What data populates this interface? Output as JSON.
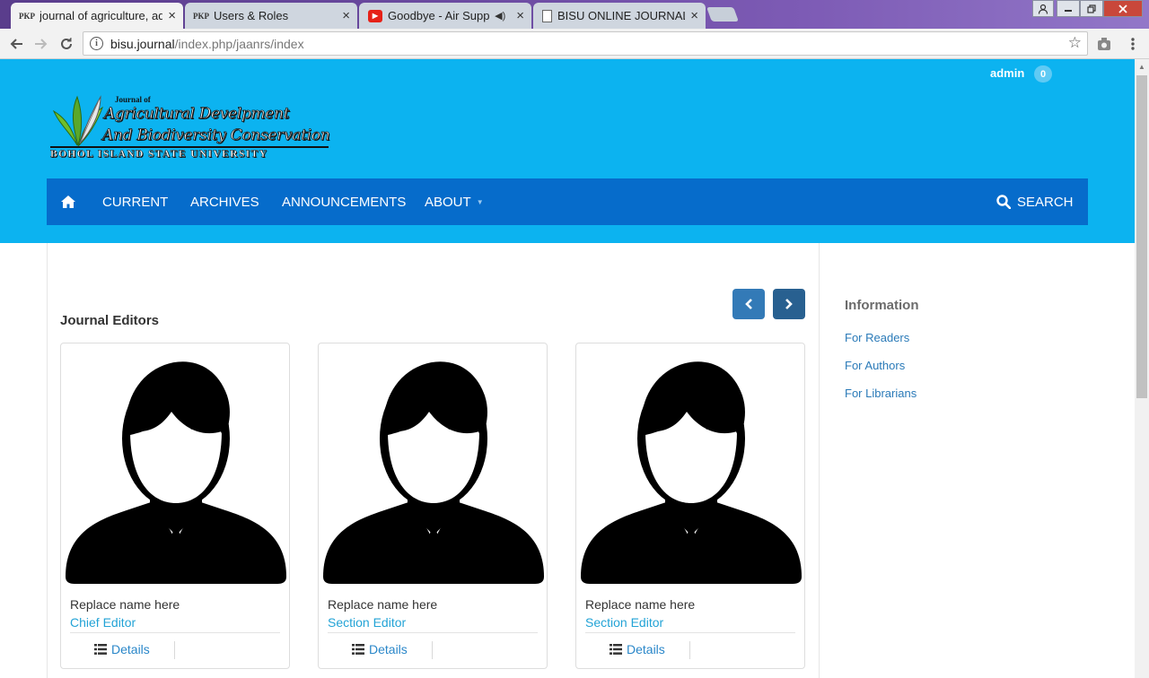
{
  "browser": {
    "tabs": [
      {
        "favicon": "PKP",
        "title": "journal of agriculture, aq",
        "active": true
      },
      {
        "favicon": "PKP",
        "title": "Users & Roles",
        "active": false
      },
      {
        "favicon": "youtube-icon",
        "title": "Goodbye - Air Supply",
        "audio": true,
        "active": false
      },
      {
        "favicon": "document-icon",
        "title": "BISU ONLINE JOURNAL",
        "active": false
      }
    ],
    "url_host": "bisu.journal",
    "url_path": "/index.php/jaanrs/index"
  },
  "header": {
    "user": "admin",
    "notifications": "0",
    "logo": {
      "small": "Journal of",
      "line1": "Agricultural Develpment",
      "line2": "And Biodiversity Conservation",
      "university": "BOHOL ISLAND STATE UNIVERSITY"
    }
  },
  "nav": {
    "items": [
      "CURRENT",
      "ARCHIVES",
      "ANNOUNCEMENTS",
      "ABOUT"
    ],
    "search": "SEARCH"
  },
  "main": {
    "section_title": "Journal Editors",
    "editors": [
      {
        "name": "Replace name here",
        "role": "Chief Editor",
        "details": "Details"
      },
      {
        "name": "Replace name here",
        "role": "Section Editor",
        "details": "Details"
      },
      {
        "name": "Replace name here",
        "role": "Section Editor",
        "details": "Details"
      }
    ]
  },
  "sidebar": {
    "title": "Information",
    "links": [
      "For Readers",
      "For Authors",
      "For Librarians"
    ]
  },
  "colors": {
    "hero": "#0cb3f0",
    "nav": "#066ccb",
    "link": "#23a3d6"
  }
}
